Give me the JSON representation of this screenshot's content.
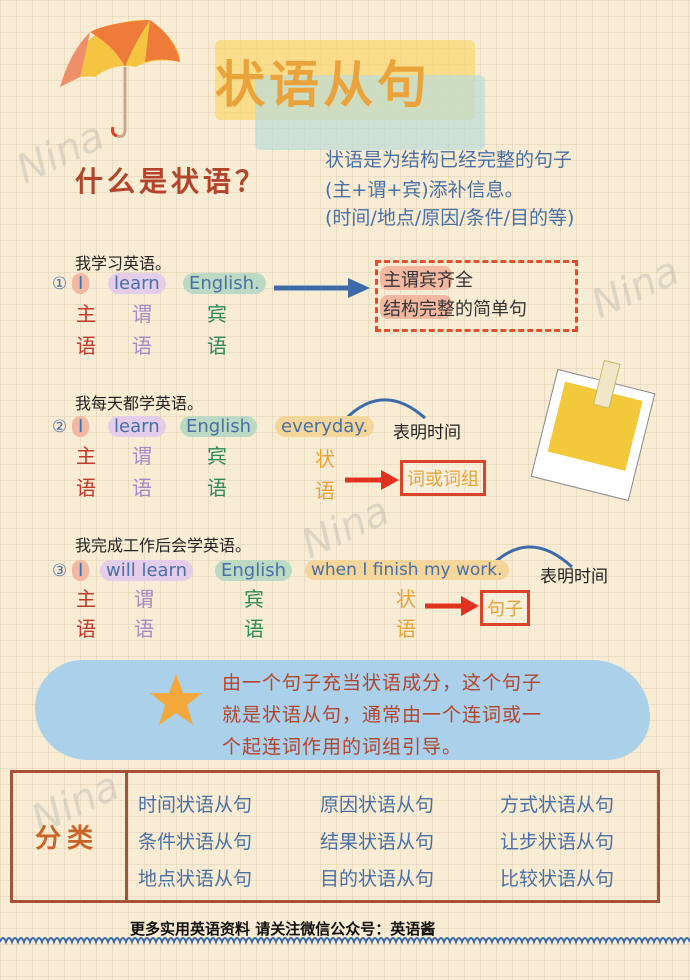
{
  "title": "状语从句",
  "question": "什么是状语？",
  "definition": [
    "状语是为结构已经完整的句子",
    "(主+谓+宾)添补信息。",
    "(时间/地点/原因/条件/目的等)"
  ],
  "examples": [
    {
      "number": "①",
      "chinese": "我学习英语。",
      "words": [
        "I",
        "learn",
        "English."
      ],
      "roles_top": [
        "主",
        "谓",
        "宾"
      ],
      "roles_bottom": [
        "语",
        "语",
        "语"
      ]
    },
    {
      "number": "②",
      "chinese": "我每天都学英语。",
      "words": [
        "I",
        "learn",
        "English",
        "everyday."
      ],
      "note": "表明时间",
      "roles_top": [
        "主",
        "谓",
        "宾",
        "状"
      ],
      "roles_bottom": [
        "语",
        "语",
        "语",
        "语"
      ],
      "result": "词或词组"
    },
    {
      "number": "③",
      "chinese": "我完成工作后会学英语。",
      "words": [
        "I",
        "will learn",
        "English",
        "when I finish my work."
      ],
      "note": "表明时间",
      "roles_top": [
        "主",
        "谓",
        "宾",
        "状"
      ],
      "roles_bottom": [
        "语",
        "语",
        "语",
        "语"
      ],
      "result": "句子"
    }
  ],
  "summary_box": [
    "主谓宾齐全",
    "结构完整的简单句"
  ],
  "cloud_text": [
    "由一个句子充当状语成分，这个句子",
    "就是状语从句，通常由一个连词或一",
    "个起连词作用的词组引导。"
  ],
  "classification": {
    "label": "分类",
    "items": [
      [
        "时间状语从句",
        "原因状语从句",
        "方式状语从句"
      ],
      [
        "条件状语从句",
        "结果状语从句",
        "让步状语从句"
      ],
      [
        "地点状语从句",
        "目的状语从句",
        "比较状语从句"
      ]
    ]
  },
  "footer": "更多实用英语资料 请关注微信公众号：英语酱",
  "watermark": "Nina",
  "colors": {
    "subject": "#c0392b",
    "predicate": "#a58ac8",
    "object": "#2e8b57",
    "adverbial": "#e8a23a",
    "text_blue": "#4a6fa5",
    "accent_red": "#d9442b"
  }
}
